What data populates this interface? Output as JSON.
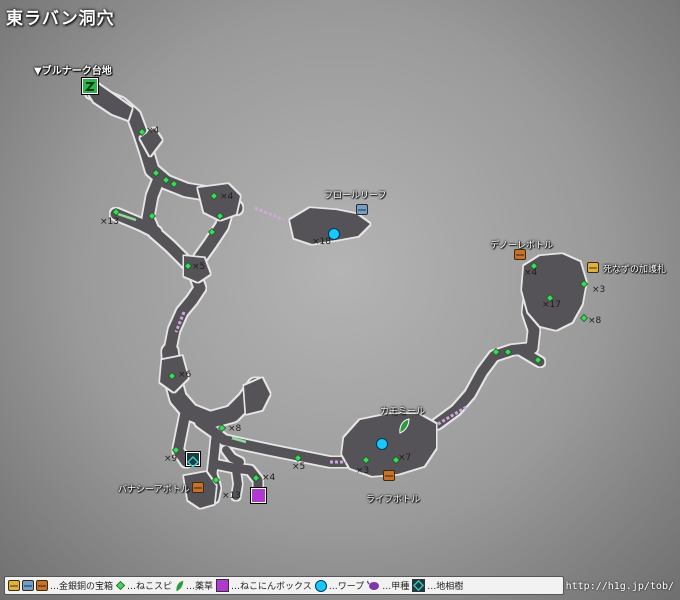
{
  "title": "東ラバン洞穴",
  "exit_label": "▼ブルナーク台地",
  "labels": {
    "floral_leaf": "フロールリーフ",
    "deno_label": "デノーレボトル",
    "shinazu": "死なずの加護札",
    "kamomile": "カモミール",
    "life_bottle": "ライフボトル",
    "banana_label": "バナシーアボトル"
  },
  "counts": {
    "c1": "×4",
    "c2": "×4",
    "c3": "×13",
    "c4": "×5",
    "c5": "×18",
    "c6": "×6",
    "c7": "×8",
    "c8": "×9",
    "c9": "×4",
    "c10": "×13",
    "c11": "×5",
    "c12": "×3",
    "c13": "×7",
    "c14": "×4",
    "c15": "×3",
    "c16": "×17",
    "c17": "×8"
  },
  "legend": {
    "chest": "…金銀銅の宝箱",
    "cat_spot": "…ねこスピ",
    "herb": "…薬草",
    "cat_box": "…ねこにんボックス",
    "warp": "…ワープ",
    "beetle": "…甲種",
    "tree": "…地相樹"
  },
  "credit": "http://h1g.jp/tob/",
  "colors": {
    "cave": "#555358",
    "cave_edge": "#e8e8e8",
    "gold_chest": "#e0b040",
    "silver_chest": "#6f9fcf",
    "bronze_chest": "#c9702a",
    "cat_spot": "#3fd65a",
    "herb": "#2e9a3e",
    "cat_box": "#b03ad0",
    "warp": "#19c8ff",
    "beetle": "#7a3aa8",
    "tree": "#36c9c9",
    "exit": "#2db34a"
  },
  "icons": {
    "exit": "exit-arrow-icon",
    "chest": "treasure-chest-icon",
    "cat_spot": "cat-spot-diamond-icon",
    "herb": "herb-leaf-icon",
    "cat_box": "cat-box-icon",
    "warp": "warp-point-icon",
    "beetle": "beetle-icon",
    "tree": "geomancy-tree-icon"
  }
}
